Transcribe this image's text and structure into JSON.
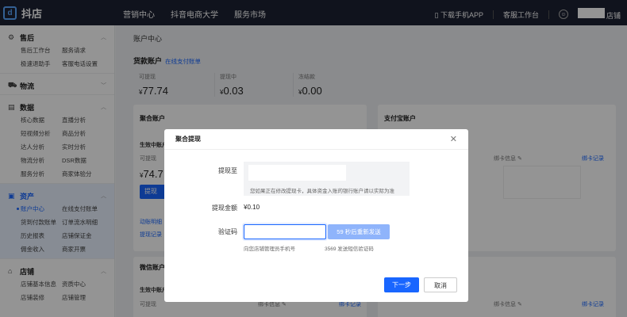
{
  "topbar": {
    "logo_icon": "dy-logo-icon",
    "brand": "抖店",
    "nav": [
      "营销中心",
      "抖音电商大学",
      "服务市场"
    ],
    "download_app": "下载手机APP",
    "service_desk": "客服工作台",
    "store_label": "店铺"
  },
  "sidebar": {
    "groups": [
      {
        "icon": "gear-icon",
        "title": "售后",
        "items": [
          "售后工作台",
          "服务请求",
          "极速退助手",
          "客服电话设置"
        ]
      },
      {
        "icon": "truck-icon",
        "title": "物流",
        "items": []
      },
      {
        "icon": "chart-icon",
        "title": "数据",
        "items": [
          "核心数据",
          "直播分析",
          "短视频分析",
          "商品分析",
          "达人分析",
          "实时分析",
          "物流分析",
          "DSR数据",
          "服务分析",
          "商家体验分"
        ]
      },
      {
        "icon": "wallet-icon",
        "title": "资产",
        "items": [
          "账户中心",
          "在线支付账单",
          "货到付款账单",
          "订单流水明细",
          "历史报表",
          "店铺保证金",
          "佣金收入",
          "商家开票"
        ]
      },
      {
        "icon": "store-icon",
        "title": "店铺",
        "items": [
          "店铺基本信息",
          "资质中心",
          "店铺装修",
          "店铺管理"
        ]
      }
    ]
  },
  "main": {
    "page_title": "账户中心",
    "section_title": "货款账户",
    "section_link": "在线支付账单",
    "stats": [
      {
        "label": "可提现",
        "value": "77.74"
      },
      {
        "label": "提现中",
        "value": "0.03"
      },
      {
        "label": "冻结款",
        "value": "0.00"
      }
    ],
    "currency": "¥",
    "card1": {
      "title": "聚合账户",
      "status": "生效中账户",
      "withdrawable": "可提现",
      "value": "74.7",
      "btn": "提现",
      "link1": "动账明细",
      "link2": "提现记录"
    },
    "card2": {
      "title": "支付宝账户",
      "bind_label": "绑卡信息",
      "bind_link": "绑卡记录"
    },
    "card3": {
      "title": "微信账户",
      "status": "生效中账户",
      "withdrawable": "可提现",
      "bind_label": "绑卡信息",
      "bind_link": "绑卡记录"
    },
    "card4": {
      "bind_label": "绑卡信息",
      "bind_link": "绑卡记录"
    }
  },
  "modal": {
    "title": "聚合提现",
    "close_icon": "close-icon",
    "label_to": "提现至",
    "bank_note": "您如果正在修改提现卡，具体资金入账的银行账户请以实际为准",
    "label_amount": "提现金额",
    "amount": "¥0.10",
    "label_code": "验证码",
    "code_value": "",
    "resend": "59 秒后重新发送",
    "hint_phone": "向您店铺管理员手机号",
    "hint_sent": "3569 发送短信验证码",
    "next": "下一步",
    "cancel": "取消"
  }
}
